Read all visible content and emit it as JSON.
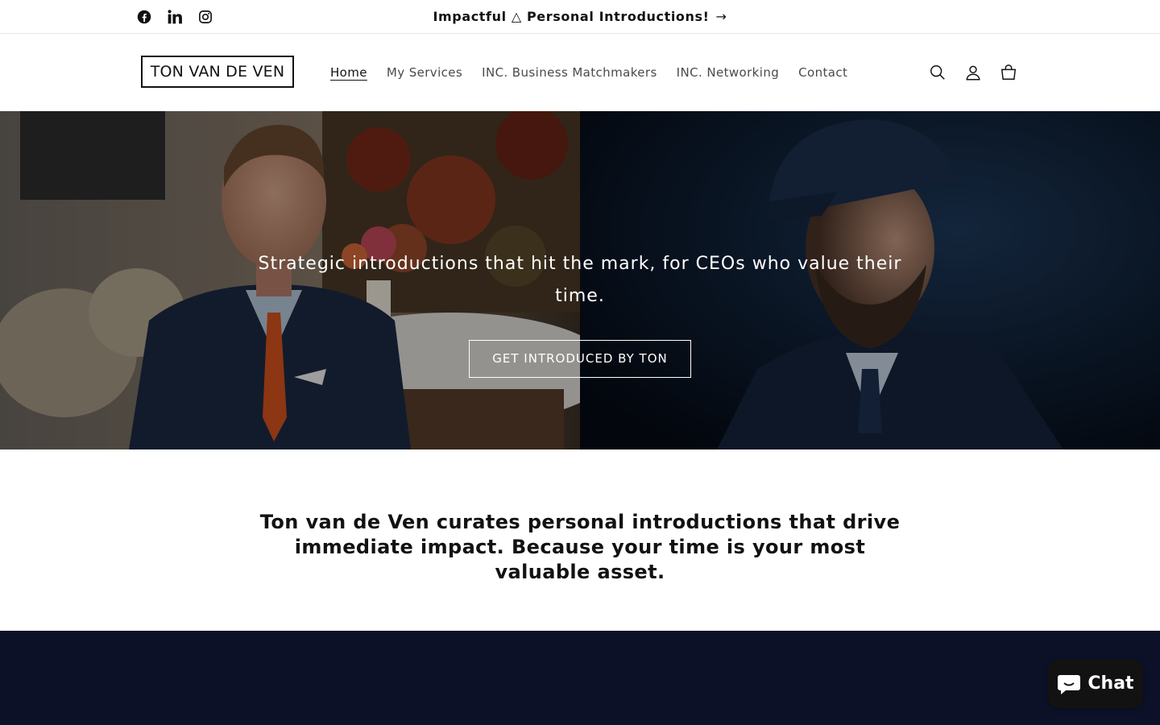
{
  "announcement": {
    "text": "Impactful △ Personal Introductions!",
    "arrow": "→"
  },
  "social": {
    "facebook": "Facebook",
    "linkedin": "LinkedIn",
    "instagram": "Instagram"
  },
  "header": {
    "logo_text": "TON VAN DE VEN",
    "nav": [
      {
        "label": "Home"
      },
      {
        "label": "My Services"
      },
      {
        "label": "INC. Business Matchmakers"
      },
      {
        "label": "INC. Networking"
      },
      {
        "label": "Contact"
      }
    ]
  },
  "hero": {
    "heading": "Strategic introductions that hit the mark, for CEOs who value their time.",
    "button": "GET INTRODUCED BY TON"
  },
  "tagline": {
    "text": "Ton van de Ven curates personal introductions that drive immediate impact. Because your time is your most valuable asset."
  },
  "chat": {
    "label": "Chat"
  },
  "colors": {
    "dark_section": "#0d1128",
    "text": "#121212"
  }
}
